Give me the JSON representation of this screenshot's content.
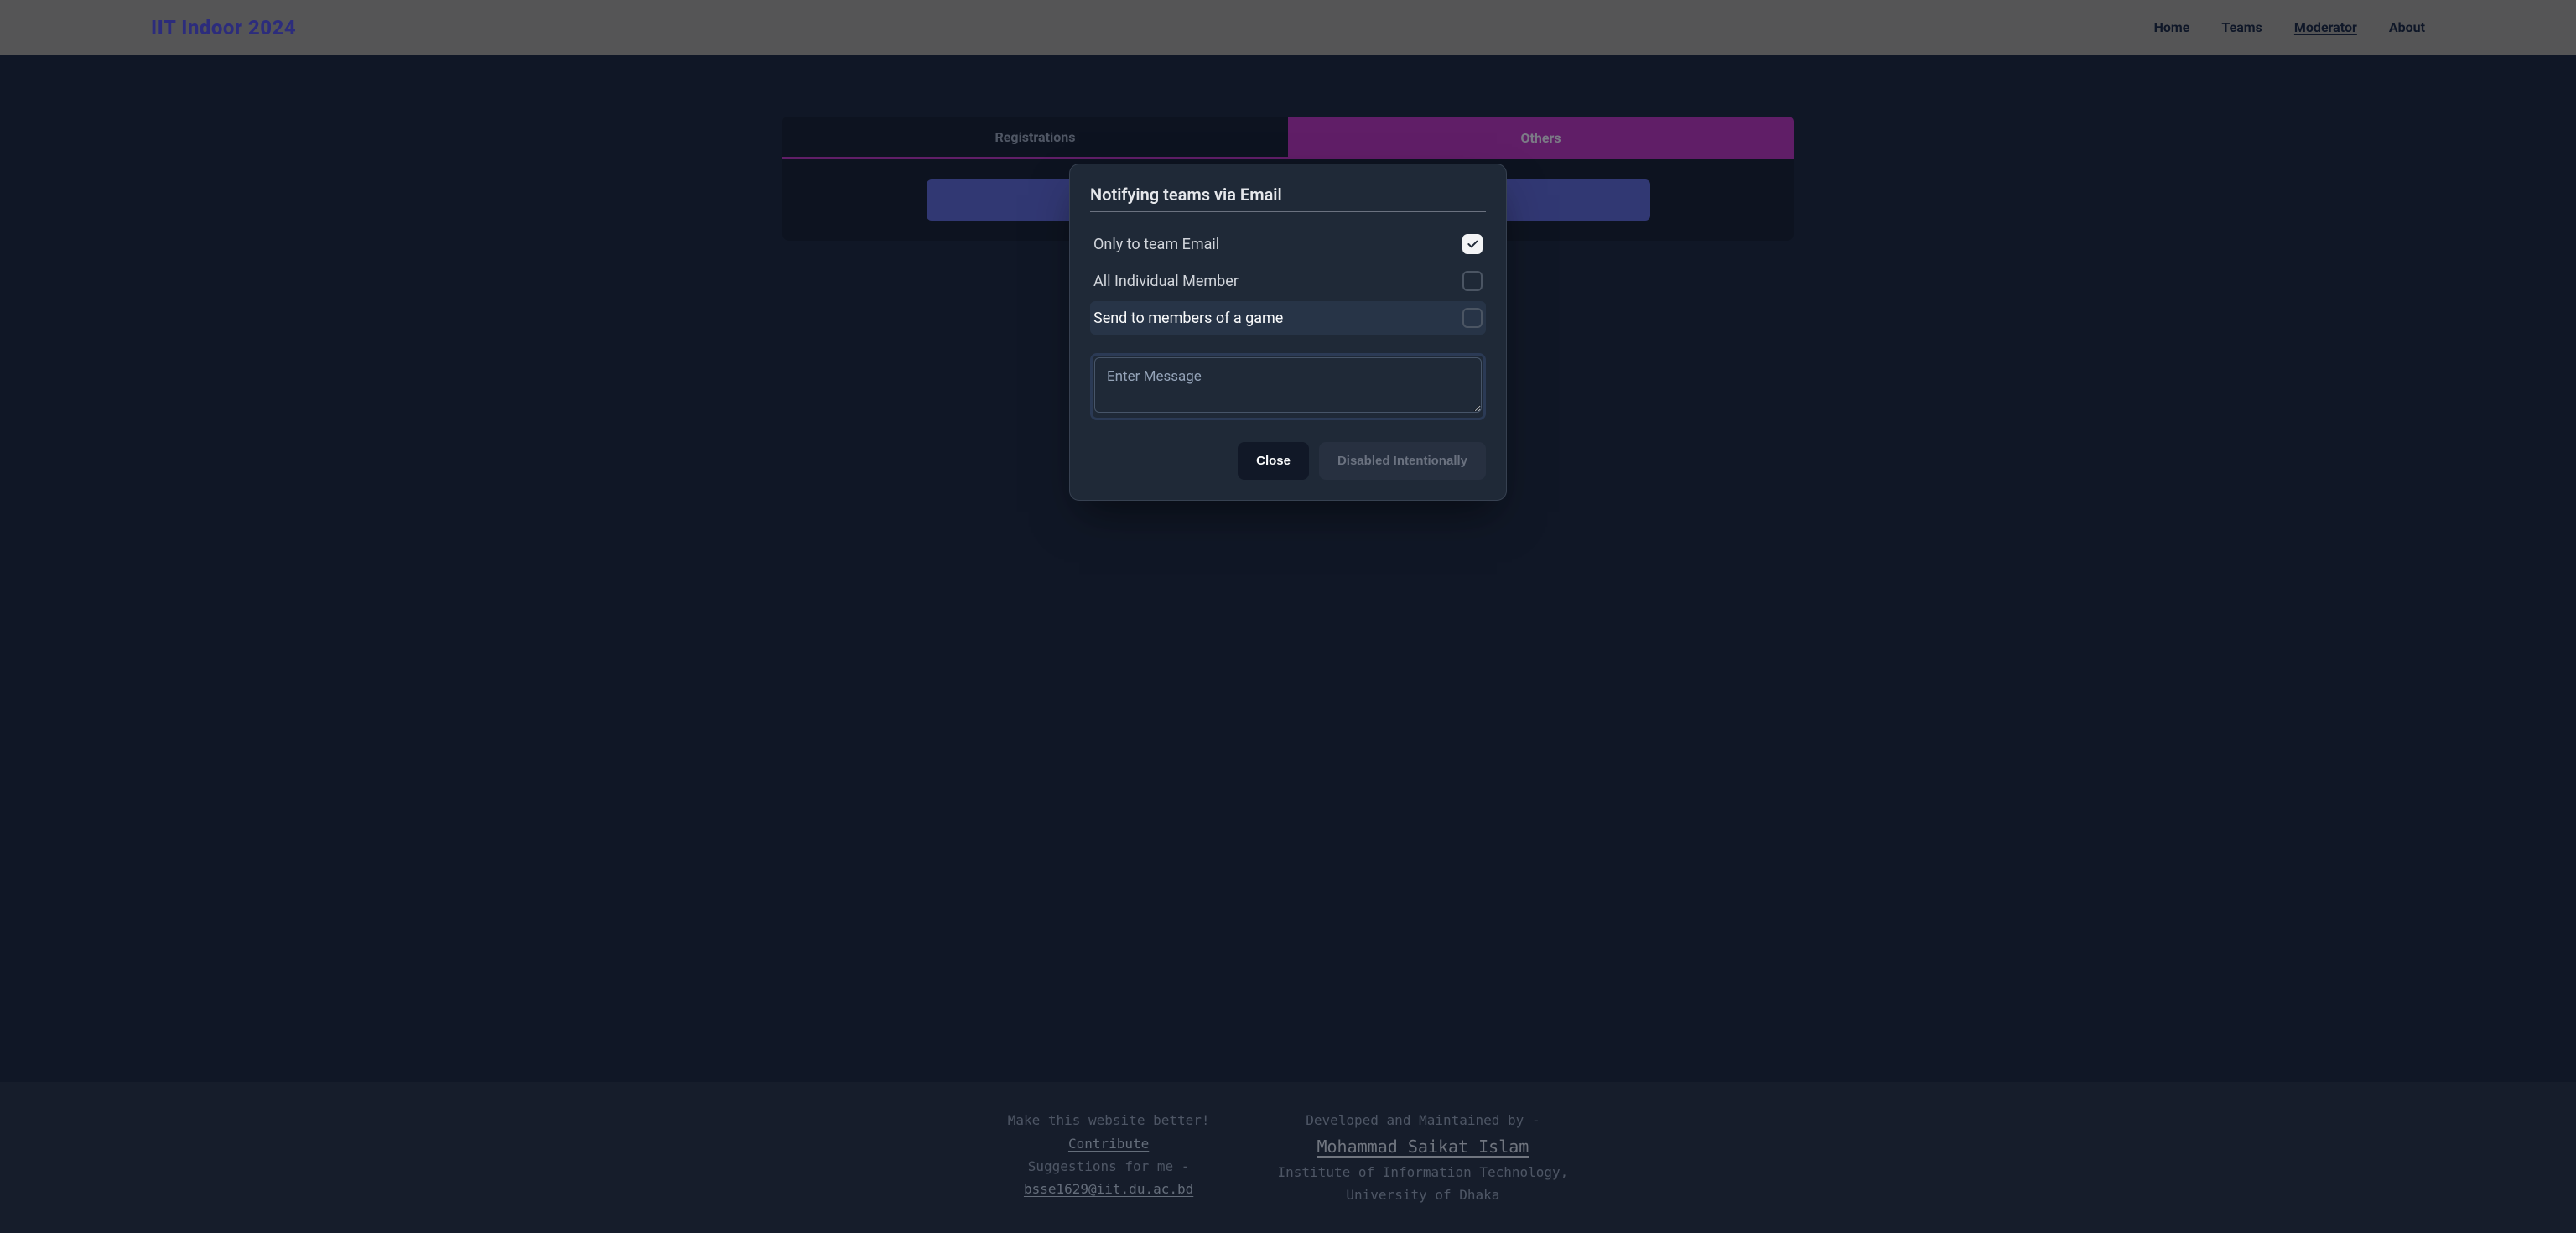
{
  "header": {
    "brand": "IIT Indoor 2024",
    "nav": {
      "home": "Home",
      "teams": "Teams",
      "moderator": "Moderator",
      "about": "About"
    }
  },
  "tabs": {
    "registrations": "Registrations",
    "others": "Others"
  },
  "modal": {
    "title": "Notifying teams via Email",
    "options": {
      "team_email": {
        "label": "Only to team Email",
        "checked": true
      },
      "individual": {
        "label": "All Individual Member",
        "checked": false
      },
      "game_members": {
        "label": "Send to members of a game",
        "checked": false
      }
    },
    "message_placeholder": "Enter Message",
    "message_value": "",
    "buttons": {
      "close": "Close",
      "disabled": "Disabled Intentionally"
    }
  },
  "footer": {
    "left": {
      "line1": "Make this website better!",
      "contribute": "Contribute",
      "line2": "Suggestions for me -",
      "email": "bsse1629@iit.du.ac.bd"
    },
    "right": {
      "line1": "Developed and Maintained by -",
      "name": "Mohammad Saikat Islam",
      "line2": "Institute of Information Technology,",
      "line3": "University of Dhaka"
    }
  }
}
